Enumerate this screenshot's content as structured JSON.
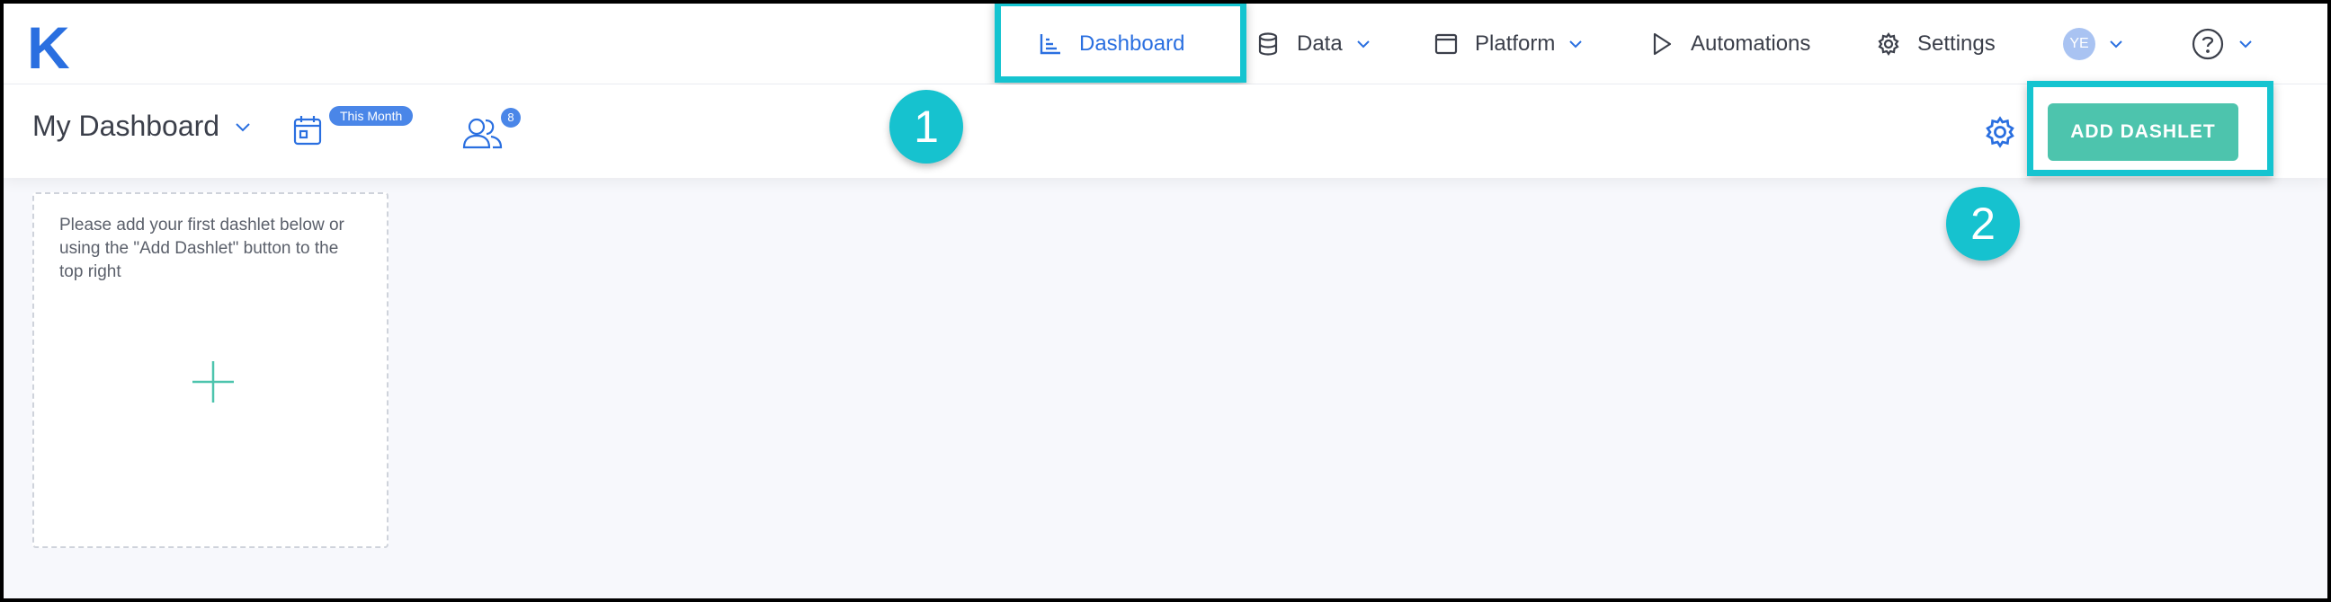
{
  "brand": {
    "logo": "K"
  },
  "nav": {
    "dashboard": "Dashboard",
    "data": "Data",
    "platform": "Platform",
    "automations": "Automations",
    "settings": "Settings",
    "avatar_initials": "YE"
  },
  "subbar": {
    "title": "My Dashboard",
    "date_badge": "This Month",
    "users_count": "8",
    "add_dashlet": "ADD DASHLET"
  },
  "card": {
    "message": "Please add your first dashlet below or using the \"Add Dashlet\" button to the top right"
  },
  "annotations": {
    "step1": "1",
    "step2": "2"
  },
  "colors": {
    "accent_blue": "#2a6fe0",
    "teal_button": "#4dc4ad",
    "callout_cyan": "#15c4d0"
  }
}
